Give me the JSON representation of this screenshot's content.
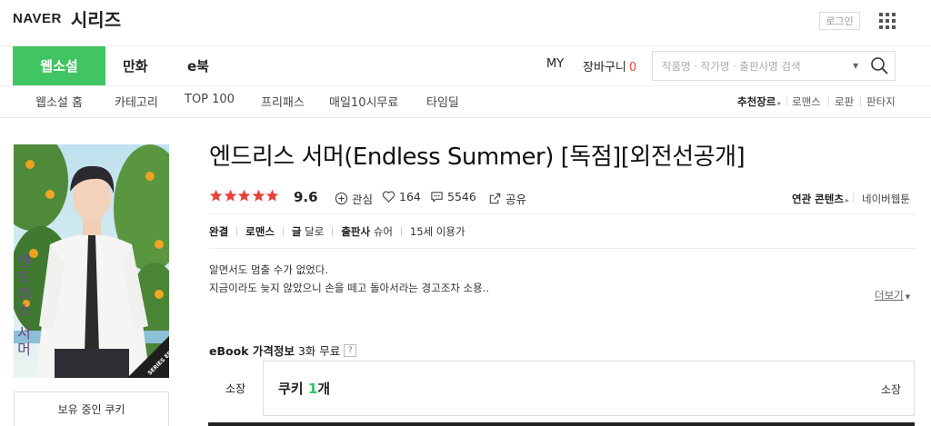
{
  "header": {
    "logo_naver": "NAVER",
    "logo_series": "시리즈",
    "login_label": "로그인"
  },
  "nav": {
    "tabs": [
      {
        "label": "웹소설",
        "active": true
      },
      {
        "label": "만화"
      },
      {
        "label": "e북"
      }
    ],
    "my_label": "MY",
    "cart_label": "장바구니",
    "cart_count": "0",
    "search_placeholder": "작품명 · 작가명 · 출판사명 검색"
  },
  "subnav": {
    "items": [
      "웹소설 홈",
      "카테고리",
      "TOP 100",
      "프리패스",
      "매일10시무료",
      "타임딜"
    ],
    "genre_label": "추천장르",
    "genres": [
      "로맨스",
      "로판",
      "판타지"
    ]
  },
  "book": {
    "title": "엔드리스 서머(Endless Summer) [독점][외전선공개]",
    "rating": "9.6",
    "star_count": 5,
    "interest_label": "관심",
    "likes": "164",
    "comments": "5546",
    "share_label": "공유",
    "related_label": "연관 콘텐츠",
    "related_value": "네이버웹툰",
    "status": "완결",
    "genre": "로맨스",
    "writer_label": "글",
    "writer": "달로",
    "publisher_label": "출판사",
    "publisher": "슈어",
    "age": "15세 이용가",
    "synopsis_1": "알면서도 멈출 수가 없었다.",
    "synopsis_2": "지금이라도 늦지 않았으니 손을 떼고 돌아서라는 경고조차 소용..",
    "more_label": "더보기",
    "cover_text": "엔드리스 서머",
    "cover_badge": "SERIES EDITION"
  },
  "sidebar": {
    "cookie_label": "보유 중인 쿠키"
  },
  "price": {
    "label": "eBook 가격정보",
    "free_info": "3화 무료",
    "help": "?",
    "own_label": "소장",
    "cookie_word": "쿠키",
    "cookie_num": "1",
    "cookie_unit": "개",
    "own_right": "소장"
  },
  "colors": {
    "brand_green": "#41c462",
    "star_red": "#e8403b",
    "cart_red": "#ff3c3c"
  }
}
